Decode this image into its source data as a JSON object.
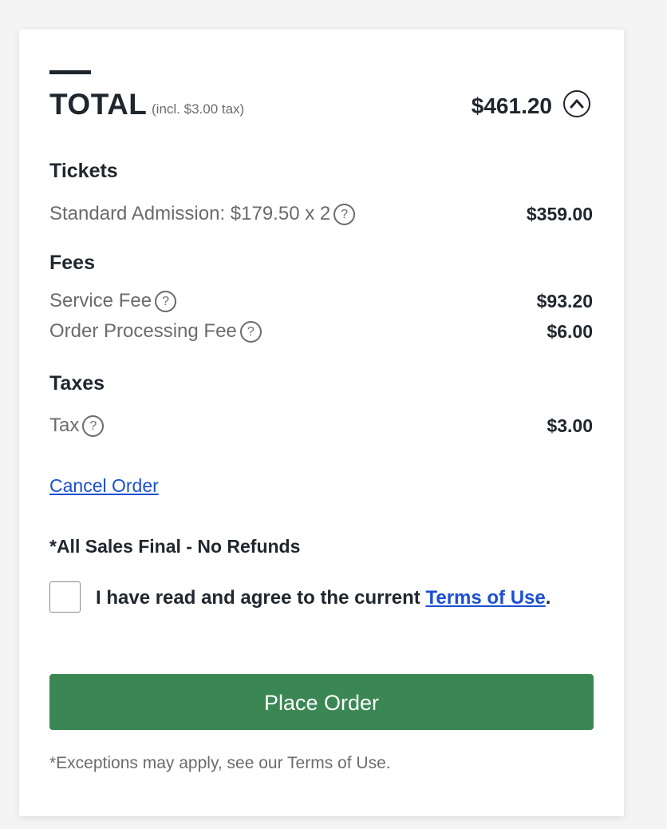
{
  "summary": {
    "title": "TOTAL",
    "tax_note": "(incl. $3.00 tax)",
    "amount": "$461.20",
    "collapse_icon": "chevron-up-icon"
  },
  "sections": {
    "tickets": {
      "title": "Tickets",
      "items": [
        {
          "label": "Standard Admission: $179.50 x 2",
          "amount": "$359.00"
        }
      ]
    },
    "fees": {
      "title": "Fees",
      "items": [
        {
          "label": "Service Fee",
          "amount": "$93.20"
        },
        {
          "label": "Order Processing Fee",
          "amount": "$6.00"
        }
      ]
    },
    "taxes": {
      "title": "Taxes",
      "items": [
        {
          "label": "Tax",
          "amount": "$3.00"
        }
      ]
    }
  },
  "help_icon_glyph": "?",
  "cancel_link": "Cancel Order",
  "sales_final": "*All Sales Final - No Refunds",
  "agreement": {
    "text_before": "I have read and agree to the current ",
    "link": "Terms of Use",
    "text_after": ".",
    "checked": false
  },
  "place_order_label": "Place Order",
  "footnote": "*Exceptions may apply, see our Terms of Use.",
  "colors": {
    "accent_green": "#3a8754",
    "link_blue": "#1c4fd1",
    "text_dark": "#1f262d",
    "text_muted": "#6b6b6b"
  }
}
